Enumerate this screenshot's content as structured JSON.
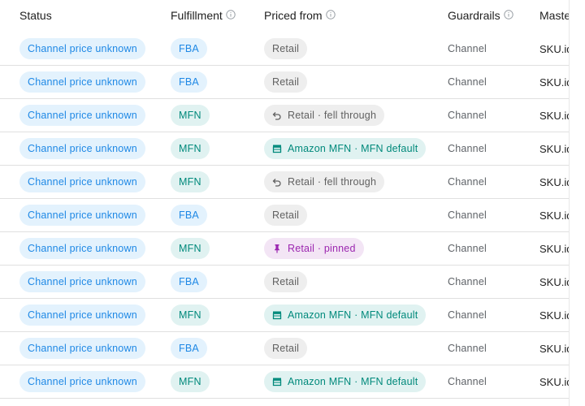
{
  "columns": {
    "status": "Status",
    "fulfillment": "Fulfillment",
    "priced_from": "Priced from",
    "guardrails": "Guardrails",
    "master": "Maste"
  },
  "rows": [
    {
      "status": "Channel price unknown",
      "fulfillment": "FBA",
      "fulfillment_kind": "fba",
      "priced": "Retail",
      "priced_kind": "retail",
      "guardrails": "Channel",
      "master": "SKU.id"
    },
    {
      "status": "Channel price unknown",
      "fulfillment": "FBA",
      "fulfillment_kind": "fba",
      "priced": "Retail",
      "priced_kind": "retail",
      "guardrails": "Channel",
      "master": "SKU.id"
    },
    {
      "status": "Channel price unknown",
      "fulfillment": "MFN",
      "fulfillment_kind": "mfn",
      "priced": "Retail · fell through",
      "priced_kind": "fell",
      "guardrails": "Channel",
      "master": "SKU.id"
    },
    {
      "status": "Channel price unknown",
      "fulfillment": "MFN",
      "fulfillment_kind": "mfn",
      "priced": "Amazon MFN · MFN default",
      "priced_kind": "amazon",
      "guardrails": "Channel",
      "master": "SKU.id"
    },
    {
      "status": "Channel price unknown",
      "fulfillment": "MFN",
      "fulfillment_kind": "mfn",
      "priced": "Retail · fell through",
      "priced_kind": "fell",
      "guardrails": "Channel",
      "master": "SKU.id"
    },
    {
      "status": "Channel price unknown",
      "fulfillment": "FBA",
      "fulfillment_kind": "fba",
      "priced": "Retail",
      "priced_kind": "retail",
      "guardrails": "Channel",
      "master": "SKU.id"
    },
    {
      "status": "Channel price unknown",
      "fulfillment": "MFN",
      "fulfillment_kind": "mfn",
      "priced": "Retail · pinned",
      "priced_kind": "pinned",
      "guardrails": "Channel",
      "master": "SKU.id"
    },
    {
      "status": "Channel price unknown",
      "fulfillment": "FBA",
      "fulfillment_kind": "fba",
      "priced": "Retail",
      "priced_kind": "retail",
      "guardrails": "Channel",
      "master": "SKU.id"
    },
    {
      "status": "Channel price unknown",
      "fulfillment": "MFN",
      "fulfillment_kind": "mfn",
      "priced": "Amazon MFN · MFN default",
      "priced_kind": "amazon",
      "guardrails": "Channel",
      "master": "SKU.id"
    },
    {
      "status": "Channel price unknown",
      "fulfillment": "FBA",
      "fulfillment_kind": "fba",
      "priced": "Retail",
      "priced_kind": "retail",
      "guardrails": "Channel",
      "master": "SKU.id"
    },
    {
      "status": "Channel price unknown",
      "fulfillment": "MFN",
      "fulfillment_kind": "mfn",
      "priced": "Amazon MFN · MFN default",
      "priced_kind": "amazon",
      "guardrails": "Channel",
      "master": "SKU.id"
    }
  ],
  "icons": {
    "info": "info-outline-icon",
    "fell": "undo-icon",
    "amazon": "storefront-icon",
    "pinned": "push-pin-icon"
  },
  "colors": {
    "status_chip_bg": "#e3f2fd",
    "status_chip_fg": "#1e88e5",
    "mfn_chip_bg": "#e0f2f1",
    "mfn_chip_fg": "#00897b",
    "retail_chip_bg": "#eeeeee",
    "retail_chip_fg": "#616161",
    "pinned_chip_bg": "#f3e5f5",
    "pinned_chip_fg": "#9c27b0"
  }
}
